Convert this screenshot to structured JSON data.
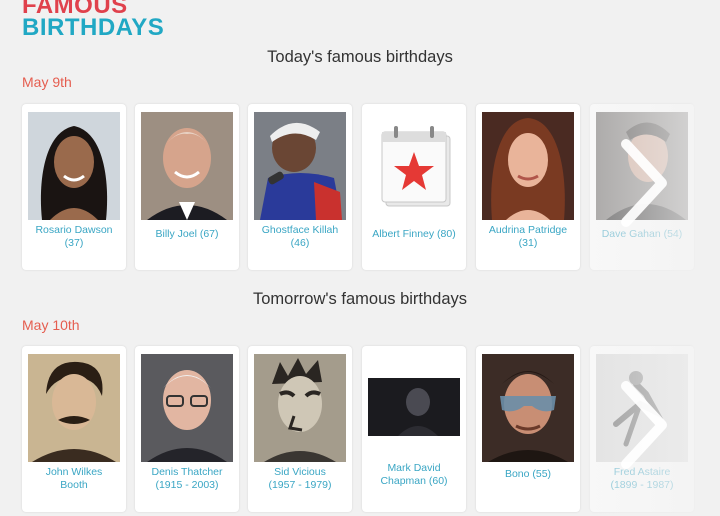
{
  "logo": {
    "line1": "FAMOUS",
    "line2": "BIRTHDAYS"
  },
  "sections": [
    {
      "title": "Today's famous birthdays",
      "date": "May 9th",
      "people": [
        {
          "name": "Rosario Dawson",
          "age": "(37)"
        },
        {
          "name": "Billy Joel (67)"
        },
        {
          "name": "Ghostface Killah",
          "age": "(46)"
        },
        {
          "name": "Albert Finney (80)"
        },
        {
          "name": "Audrina Patridge",
          "age": "(31)"
        },
        {
          "name": "Dave Gahan (54)"
        }
      ]
    },
    {
      "title": "Tomorrow's famous birthdays",
      "date": "May 10th",
      "people": [
        {
          "name": "John Wilkes",
          "age": "Booth"
        },
        {
          "name": "Denis Thatcher",
          "age": "(1915 - 2003)"
        },
        {
          "name": "Sid Vicious",
          "age": "(1957 - 1979)"
        },
        {
          "name": "Mark David",
          "age": "Chapman (60)"
        },
        {
          "name": "Bono (55)"
        },
        {
          "name": "Fred Astaire",
          "age": "(1899 - 1987)"
        }
      ]
    }
  ],
  "icons": {
    "next": "chevron-right-icon",
    "calendar": "calendar-star-icon"
  },
  "colors": {
    "accent_red": "#e0414c",
    "accent_blue": "#21a8c4",
    "name_link": "#3aa6c4",
    "date_red": "#e55d4f"
  }
}
